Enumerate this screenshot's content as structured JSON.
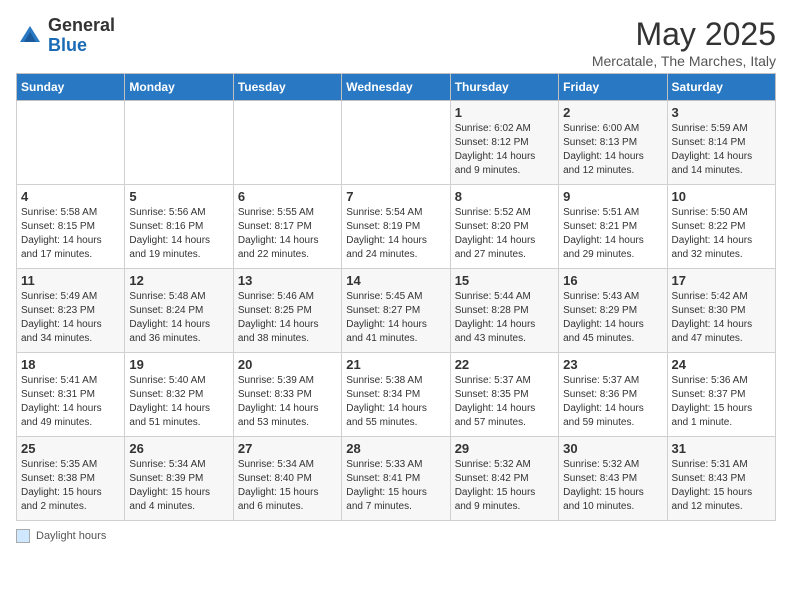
{
  "logo": {
    "general": "General",
    "blue": "Blue"
  },
  "title": "May 2025",
  "subtitle": "Mercatale, The Marches, Italy",
  "days_of_week": [
    "Sunday",
    "Monday",
    "Tuesday",
    "Wednesday",
    "Thursday",
    "Friday",
    "Saturday"
  ],
  "footer_label": "Daylight hours",
  "weeks": [
    [
      {
        "day": "",
        "info": ""
      },
      {
        "day": "",
        "info": ""
      },
      {
        "day": "",
        "info": ""
      },
      {
        "day": "",
        "info": ""
      },
      {
        "day": "1",
        "info": "Sunrise: 6:02 AM\nSunset: 8:12 PM\nDaylight: 14 hours\nand 9 minutes."
      },
      {
        "day": "2",
        "info": "Sunrise: 6:00 AM\nSunset: 8:13 PM\nDaylight: 14 hours\nand 12 minutes."
      },
      {
        "day": "3",
        "info": "Sunrise: 5:59 AM\nSunset: 8:14 PM\nDaylight: 14 hours\nand 14 minutes."
      }
    ],
    [
      {
        "day": "4",
        "info": "Sunrise: 5:58 AM\nSunset: 8:15 PM\nDaylight: 14 hours\nand 17 minutes."
      },
      {
        "day": "5",
        "info": "Sunrise: 5:56 AM\nSunset: 8:16 PM\nDaylight: 14 hours\nand 19 minutes."
      },
      {
        "day": "6",
        "info": "Sunrise: 5:55 AM\nSunset: 8:17 PM\nDaylight: 14 hours\nand 22 minutes."
      },
      {
        "day": "7",
        "info": "Sunrise: 5:54 AM\nSunset: 8:19 PM\nDaylight: 14 hours\nand 24 minutes."
      },
      {
        "day": "8",
        "info": "Sunrise: 5:52 AM\nSunset: 8:20 PM\nDaylight: 14 hours\nand 27 minutes."
      },
      {
        "day": "9",
        "info": "Sunrise: 5:51 AM\nSunset: 8:21 PM\nDaylight: 14 hours\nand 29 minutes."
      },
      {
        "day": "10",
        "info": "Sunrise: 5:50 AM\nSunset: 8:22 PM\nDaylight: 14 hours\nand 32 minutes."
      }
    ],
    [
      {
        "day": "11",
        "info": "Sunrise: 5:49 AM\nSunset: 8:23 PM\nDaylight: 14 hours\nand 34 minutes."
      },
      {
        "day": "12",
        "info": "Sunrise: 5:48 AM\nSunset: 8:24 PM\nDaylight: 14 hours\nand 36 minutes."
      },
      {
        "day": "13",
        "info": "Sunrise: 5:46 AM\nSunset: 8:25 PM\nDaylight: 14 hours\nand 38 minutes."
      },
      {
        "day": "14",
        "info": "Sunrise: 5:45 AM\nSunset: 8:27 PM\nDaylight: 14 hours\nand 41 minutes."
      },
      {
        "day": "15",
        "info": "Sunrise: 5:44 AM\nSunset: 8:28 PM\nDaylight: 14 hours\nand 43 minutes."
      },
      {
        "day": "16",
        "info": "Sunrise: 5:43 AM\nSunset: 8:29 PM\nDaylight: 14 hours\nand 45 minutes."
      },
      {
        "day": "17",
        "info": "Sunrise: 5:42 AM\nSunset: 8:30 PM\nDaylight: 14 hours\nand 47 minutes."
      }
    ],
    [
      {
        "day": "18",
        "info": "Sunrise: 5:41 AM\nSunset: 8:31 PM\nDaylight: 14 hours\nand 49 minutes."
      },
      {
        "day": "19",
        "info": "Sunrise: 5:40 AM\nSunset: 8:32 PM\nDaylight: 14 hours\nand 51 minutes."
      },
      {
        "day": "20",
        "info": "Sunrise: 5:39 AM\nSunset: 8:33 PM\nDaylight: 14 hours\nand 53 minutes."
      },
      {
        "day": "21",
        "info": "Sunrise: 5:38 AM\nSunset: 8:34 PM\nDaylight: 14 hours\nand 55 minutes."
      },
      {
        "day": "22",
        "info": "Sunrise: 5:37 AM\nSunset: 8:35 PM\nDaylight: 14 hours\nand 57 minutes."
      },
      {
        "day": "23",
        "info": "Sunrise: 5:37 AM\nSunset: 8:36 PM\nDaylight: 14 hours\nand 59 minutes."
      },
      {
        "day": "24",
        "info": "Sunrise: 5:36 AM\nSunset: 8:37 PM\nDaylight: 15 hours\nand 1 minute."
      }
    ],
    [
      {
        "day": "25",
        "info": "Sunrise: 5:35 AM\nSunset: 8:38 PM\nDaylight: 15 hours\nand 2 minutes."
      },
      {
        "day": "26",
        "info": "Sunrise: 5:34 AM\nSunset: 8:39 PM\nDaylight: 15 hours\nand 4 minutes."
      },
      {
        "day": "27",
        "info": "Sunrise: 5:34 AM\nSunset: 8:40 PM\nDaylight: 15 hours\nand 6 minutes."
      },
      {
        "day": "28",
        "info": "Sunrise: 5:33 AM\nSunset: 8:41 PM\nDaylight: 15 hours\nand 7 minutes."
      },
      {
        "day": "29",
        "info": "Sunrise: 5:32 AM\nSunset: 8:42 PM\nDaylight: 15 hours\nand 9 minutes."
      },
      {
        "day": "30",
        "info": "Sunrise: 5:32 AM\nSunset: 8:43 PM\nDaylight: 15 hours\nand 10 minutes."
      },
      {
        "day": "31",
        "info": "Sunrise: 5:31 AM\nSunset: 8:43 PM\nDaylight: 15 hours\nand 12 minutes."
      }
    ]
  ]
}
